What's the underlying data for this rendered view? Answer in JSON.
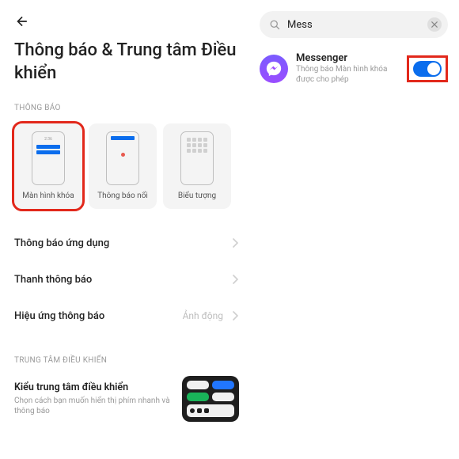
{
  "left": {
    "title": "Thông báo & Trung tâm Điều khiển",
    "section_notifications": "THÔNG BÁO",
    "tiles": {
      "lock": "Màn hình khóa",
      "float": "Thông báo nổi",
      "badge": "Biểu tượng",
      "lock_time": "2:36"
    },
    "rows": {
      "app_notif": "Thông báo ứng dụng",
      "status_bar": "Thanh thông báo",
      "effect": "Hiệu ứng thông báo",
      "effect_val": "Ảnh động"
    },
    "section_control": "TRUNG TÂM ĐIỀU KHIỂN",
    "cc_title": "Kiểu trung tâm điều khiển",
    "cc_sub": "Chọn cách bạn muốn hiển thị phím nhanh và thông báo"
  },
  "right": {
    "search_value": "Mess",
    "result_title": "Messenger",
    "result_sub": "Thông báo Màn hình khóa được cho phép"
  }
}
